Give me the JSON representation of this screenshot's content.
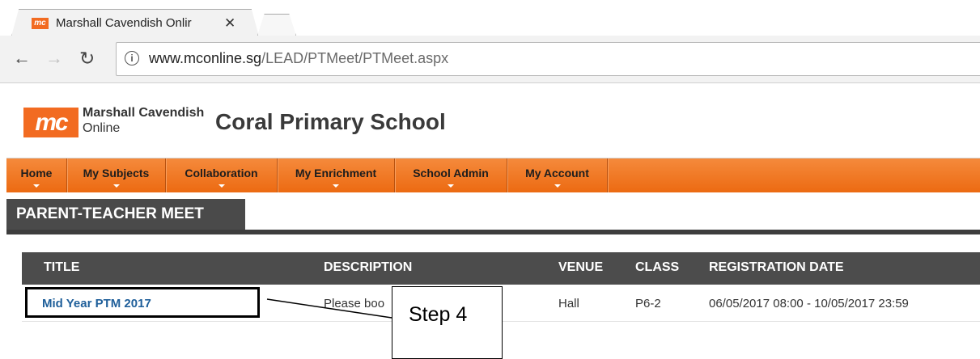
{
  "browser": {
    "tab_title": "Marshall Cavendish Onlir",
    "favicon_text": "mc",
    "url_host": "www.mconline.sg",
    "url_path": "/LEAD/PTMeet/PTMeet.aspx"
  },
  "header": {
    "logo_text": "mc",
    "brand_line1": "Marshall Cavendish",
    "brand_line2": "Online",
    "school_name": "Coral Primary School"
  },
  "menu": {
    "items": [
      {
        "label": "Home"
      },
      {
        "label": "My Subjects"
      },
      {
        "label": "Collaboration"
      },
      {
        "label": "My Enrichment"
      },
      {
        "label": "School Admin"
      },
      {
        "label": "My Account"
      }
    ]
  },
  "page": {
    "title": "PARENT-TEACHER MEET"
  },
  "table": {
    "columns": [
      "TITLE",
      "DESCRIPTION",
      "VENUE",
      "CLASS",
      "REGISTRATION DATE"
    ],
    "rows": [
      {
        "title": "Mid Year PTM 2017",
        "description": "Please boo",
        "venue": "Hall",
        "class": "P6-2",
        "registration_date": "06/05/2017 08:00 - 10/05/2017 23:59"
      }
    ]
  },
  "annotation": {
    "callout_text": "Step 4"
  },
  "colors": {
    "brand_orange": "#f26b21",
    "menu_gradient_top": "#f58a3c",
    "header_dark": "#4c4c4c",
    "link_blue": "#1f5f9a"
  }
}
